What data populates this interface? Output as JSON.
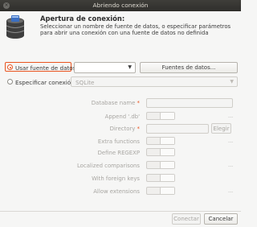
{
  "window": {
    "title": "Abriendo conexión",
    "close_glyph": "×"
  },
  "header": {
    "icon": "database-icon",
    "title": "Apertura de conexión:",
    "description": "Seleccionar un nombre de fuente de datos, o especificar parámetros para abrir una conexión con una fuente de datos no definida"
  },
  "datasource": {
    "radio_label": "Usar fuente de datos:",
    "selected": true,
    "combo_value": "",
    "button_label": "Fuentes de datos..."
  },
  "connection": {
    "radio_label": "Especificar conexión:",
    "selected": false,
    "driver_value": "SQLite"
  },
  "fields": {
    "database_name": "Database name",
    "append_db": "Append '.db'",
    "directory": "Directory",
    "choose_button": "Elegir",
    "extra_functions": "Extra functions",
    "define_regexp": "Define REGEXP",
    "localized_comparisons": "Localized comparisons",
    "with_foreign_keys": "With foreign keys",
    "allow_extensions": "Allow extensions",
    "required_mark": "*",
    "ellipsis": "..."
  },
  "footer": {
    "connect_label": "Conectar",
    "cancel_label": "Cancelar"
  },
  "colors": {
    "accent": "#e95420",
    "titlebar": "#3a3935"
  }
}
